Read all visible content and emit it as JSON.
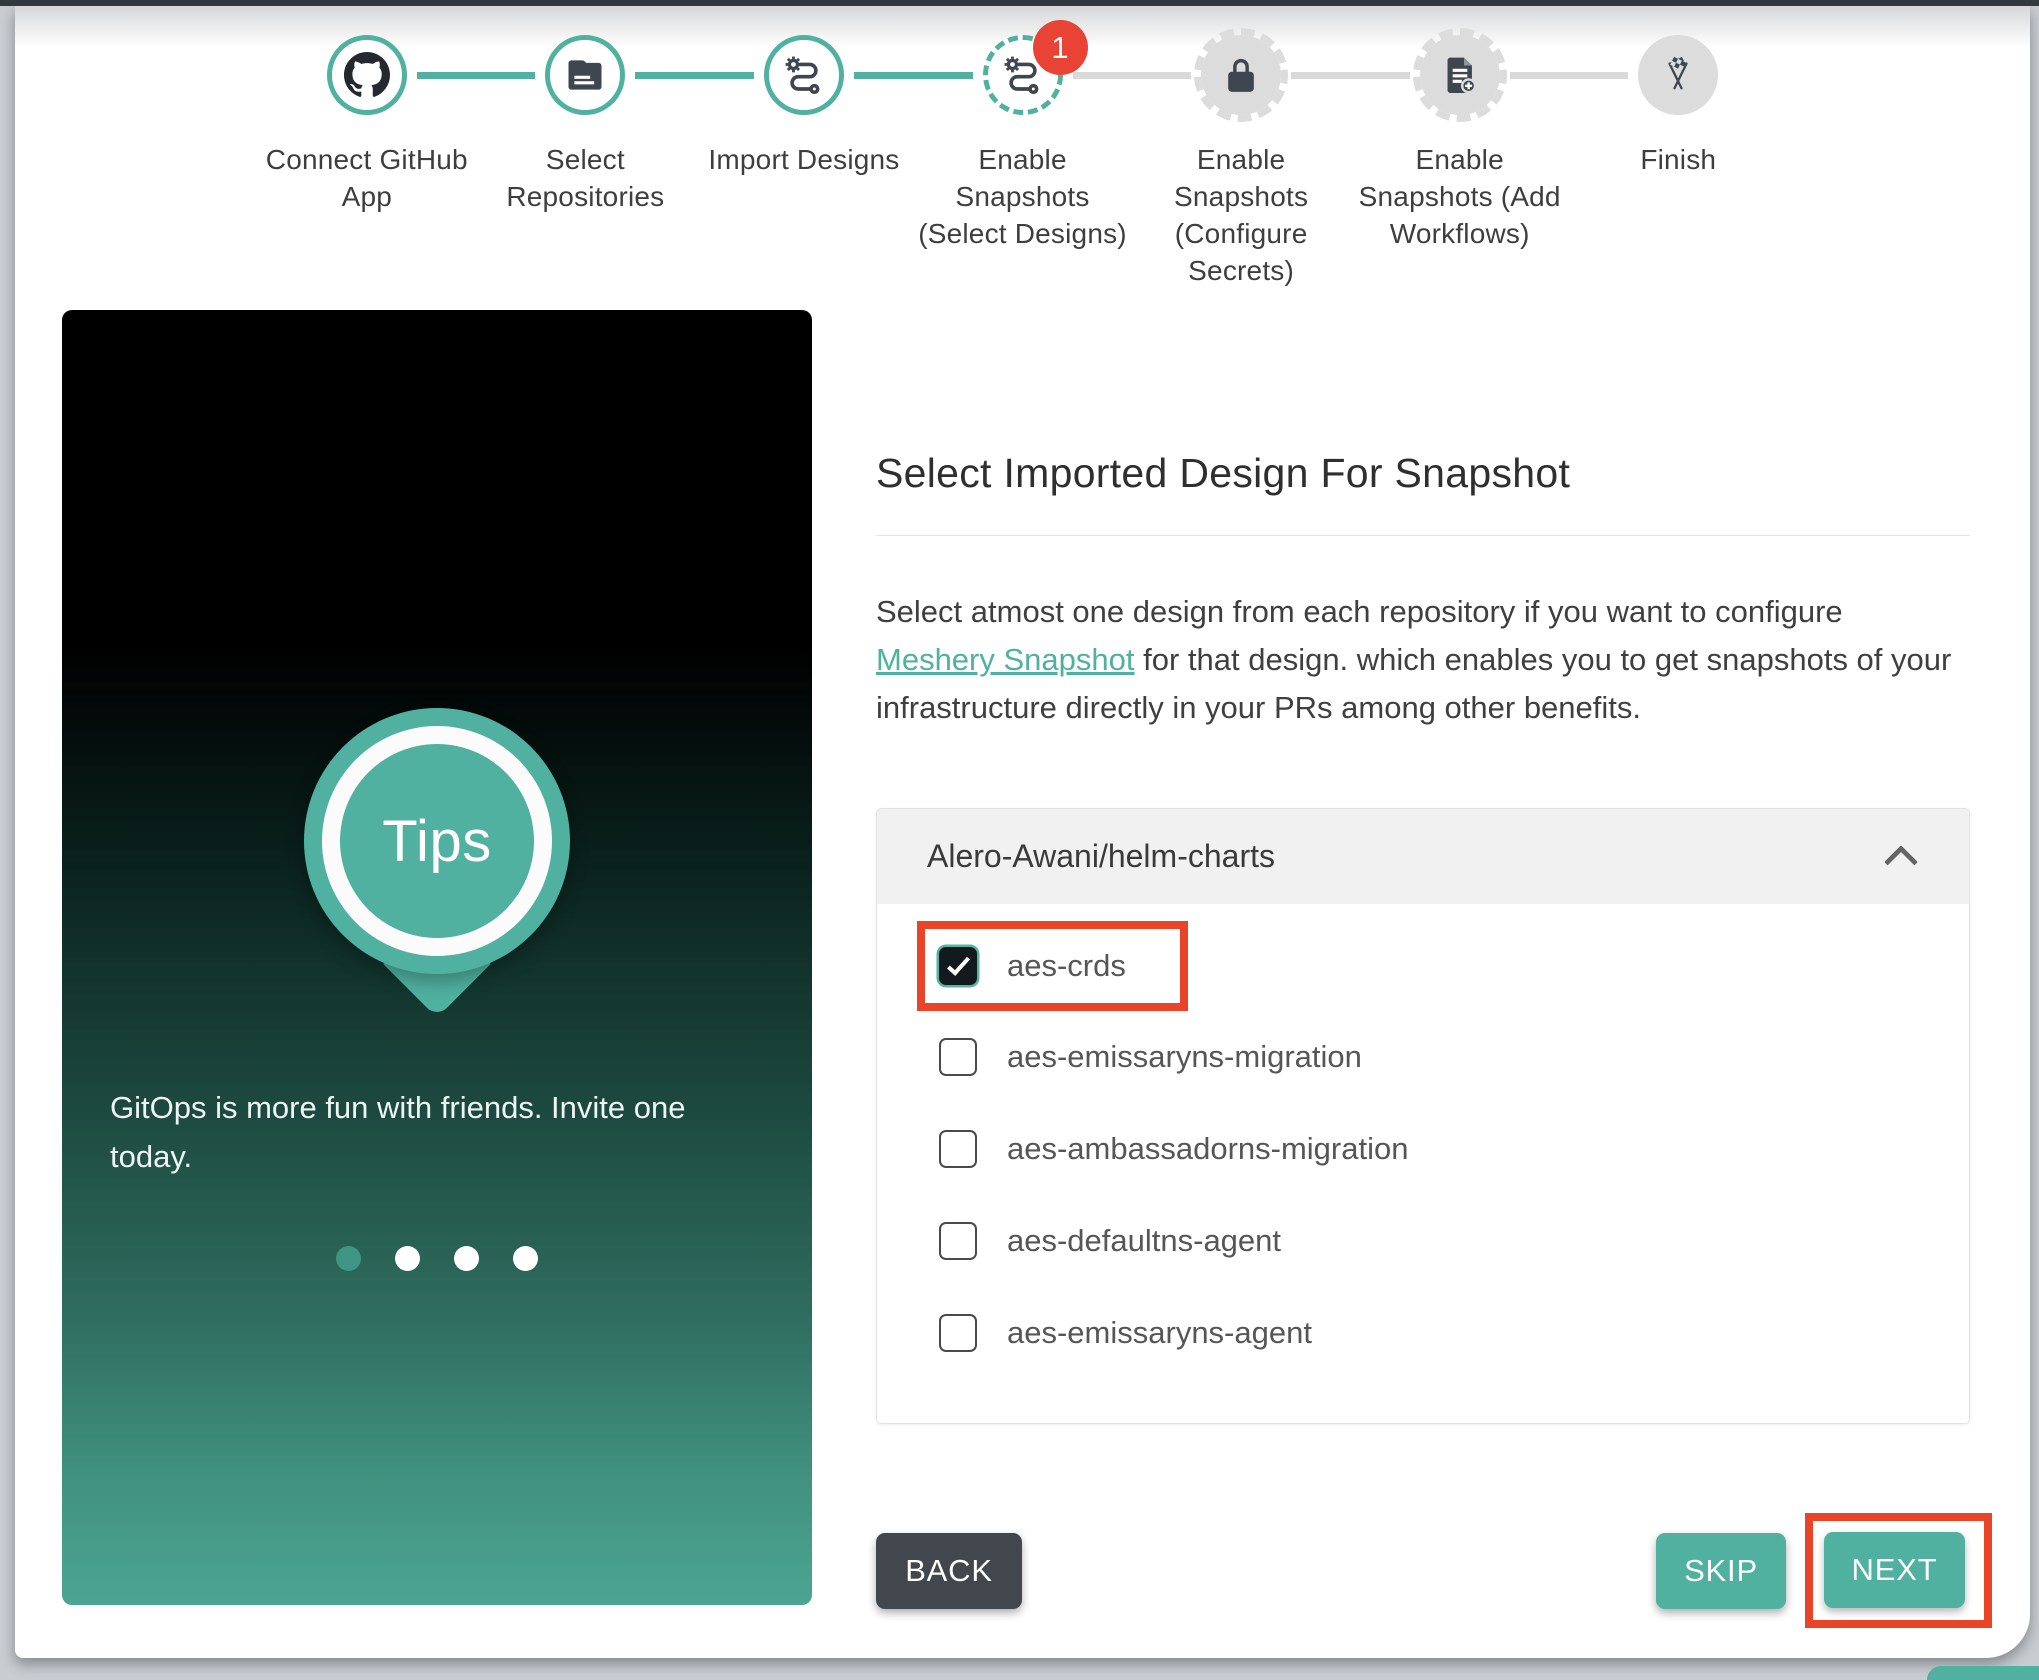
{
  "stepper": {
    "steps": [
      {
        "label": "Connect GitHub App",
        "icon": "github-icon",
        "state": "completed"
      },
      {
        "label": "Select Repositories",
        "icon": "repository-icon",
        "state": "completed"
      },
      {
        "label": "Import Designs",
        "icon": "design-route-icon",
        "state": "completed"
      },
      {
        "label": "Enable Snapshots (Select Designs)",
        "icon": "design-route-icon",
        "state": "active",
        "badge": "1"
      },
      {
        "label": "Enable Snapshots (Configure Secrets)",
        "icon": "lock-icon",
        "state": "upcoming"
      },
      {
        "label": "Enable Snapshots (Add Workflows)",
        "icon": "document-add-icon",
        "state": "upcoming"
      },
      {
        "label": "Finish",
        "icon": "finish-flags-icon",
        "state": "upcoming"
      }
    ]
  },
  "tips_panel": {
    "badge_label": "Tips",
    "message": "GitOps is more fun with friends. Invite one today.",
    "carousel_dots": 4,
    "active_dot": 1
  },
  "main": {
    "title": "Select Imported Design For Snapshot",
    "description": {
      "before": "Select atmost one design from each repository if you want to configure ",
      "link": "Meshery Snapshot",
      "after": " for that design. which enables you to get snapshots of your infrastructure directly in your PRs among other benefits."
    },
    "repository": {
      "name": "Alero-Awani/helm-charts",
      "designs": [
        {
          "label": "aes-crds",
          "checked": true,
          "annotated": true
        },
        {
          "label": "aes-emissaryns-migration",
          "checked": false
        },
        {
          "label": "aes-ambassadorns-migration",
          "checked": false
        },
        {
          "label": "aes-defaultns-agent",
          "checked": false
        },
        {
          "label": "aes-emissaryns-agent",
          "checked": false
        }
      ]
    },
    "buttons": {
      "back": "BACK",
      "skip": "SKIP",
      "next": "NEXT"
    }
  },
  "colors": {
    "accent_teal": "#50B1A0",
    "annotation_red": "#EA4428",
    "badge_red": "#E94335",
    "dark_button": "#41474D",
    "step_gray": "#DCDCDC"
  }
}
